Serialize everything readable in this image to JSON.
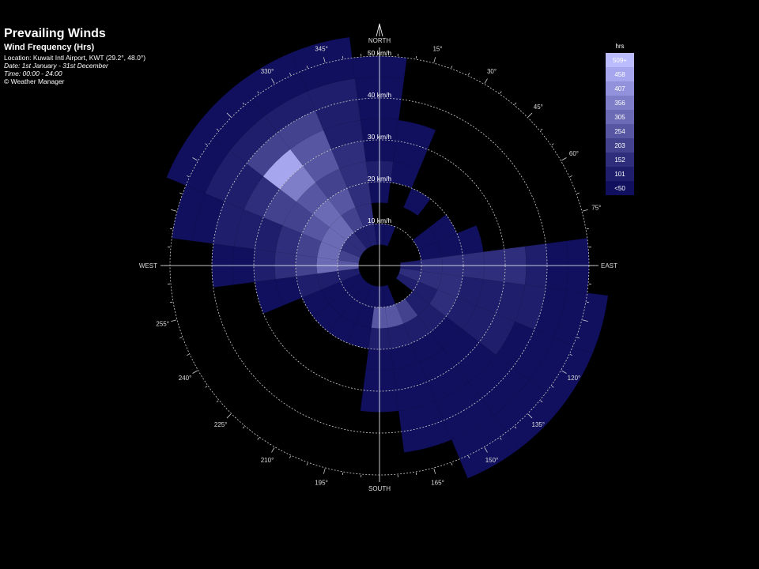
{
  "header": {
    "title": "Prevailing Winds",
    "subtitle": "Wind Frequency (Hrs)",
    "location": "Location: Kuwait Intl Airport, KWT (29.2°, 48.0°)",
    "date": "Date: 1st January - 31st December",
    "time": "Time: 00:00 - 24:00",
    "copyright": "© Weather Manager"
  },
  "chart_data": {
    "type": "wind-rose",
    "units": "km/h",
    "legend_title": "hrs",
    "cardinals": [
      "NORTH",
      "EAST",
      "SOUTH",
      "WEST"
    ],
    "speed_rings": [
      10,
      20,
      30,
      40,
      50
    ],
    "speed_labels": [
      "10 km/h",
      "20 km/h",
      "30 km/h",
      "40 km/h",
      "50 km/h"
    ],
    "direction_labels": [
      "15°",
      "30°",
      "45°",
      "60°",
      "75°",
      "120°",
      "135°",
      "150°",
      "165°",
      "195°",
      "210°",
      "225°",
      "240°",
      "255°",
      "330°",
      "345°"
    ],
    "legend": [
      {
        "label": "509+",
        "color": "#bbbbff"
      },
      {
        "label": "458",
        "color": "#a6a6ee"
      },
      {
        "label": "407",
        "color": "#9292dc"
      },
      {
        "label": "356",
        "color": "#7e7ec8"
      },
      {
        "label": "305",
        "color": "#6a6ab5"
      },
      {
        "label": "254",
        "color": "#5656a2"
      },
      {
        "label": "203",
        "color": "#42428f"
      },
      {
        "label": "152",
        "color": "#2e2e7c"
      },
      {
        "label": "101",
        "color": "#1e1e6c"
      },
      {
        "label": "<50",
        "color": "#10105e"
      }
    ],
    "colors": {
      "background": "#000000",
      "grid": "#cfcfcf"
    },
    "sector_width_deg": 15,
    "speed_bins": [
      [
        5,
        10
      ],
      [
        10,
        15
      ],
      [
        15,
        20
      ],
      [
        20,
        25
      ],
      [
        25,
        30
      ],
      [
        30,
        35
      ],
      [
        35,
        40
      ],
      [
        40,
        45
      ],
      [
        45,
        50
      ],
      [
        50,
        55
      ]
    ],
    "frequency_bins": [
      {
        "dir": 0,
        "levels": [
          1,
          0,
          1,
          2,
          1,
          1,
          1,
          1,
          1,
          0
        ]
      },
      {
        "dir": 15,
        "levels": [
          1,
          0,
          0,
          1,
          1,
          1,
          0,
          0,
          0,
          0
        ]
      },
      {
        "dir": 30,
        "levels": [
          0,
          0,
          1,
          0,
          0,
          0,
          0,
          0,
          0,
          0
        ]
      },
      {
        "dir": 45,
        "levels": [
          0,
          0,
          0,
          0,
          0,
          0,
          0,
          0,
          0,
          0
        ]
      },
      {
        "dir": 60,
        "levels": [
          0,
          1,
          1,
          0,
          0,
          0,
          0,
          0,
          0,
          0
        ]
      },
      {
        "dir": 75,
        "levels": [
          0,
          1,
          1,
          1,
          0,
          0,
          0,
          0,
          0,
          0
        ]
      },
      {
        "dir": 90,
        "levels": [
          2,
          3,
          3,
          3,
          3,
          3,
          2,
          1,
          1,
          0
        ]
      },
      {
        "dir": 105,
        "levels": [
          3,
          3,
          3,
          2,
          2,
          2,
          2,
          1,
          1,
          1
        ]
      },
      {
        "dir": 120,
        "levels": [
          2,
          2,
          3,
          2,
          2,
          2,
          1,
          1,
          1,
          1
        ]
      },
      {
        "dir": 135,
        "levels": [
          0,
          2,
          2,
          1,
          1,
          1,
          1,
          1,
          1,
          1
        ]
      },
      {
        "dir": 150,
        "levels": [
          0,
          4,
          2,
          1,
          1,
          1,
          1,
          1,
          1,
          1
        ]
      },
      {
        "dir": 165,
        "levels": [
          1,
          5,
          2,
          1,
          1,
          1,
          1,
          1,
          0,
          0
        ]
      },
      {
        "dir": 180,
        "levels": [
          1,
          5,
          2,
          1,
          1,
          1,
          0,
          0,
          0,
          0
        ]
      },
      {
        "dir": 195,
        "levels": [
          1,
          1,
          1,
          0,
          0,
          0,
          0,
          0,
          0,
          0
        ]
      },
      {
        "dir": 210,
        "levels": [
          1,
          1,
          1,
          0,
          0,
          0,
          0,
          0,
          0,
          0
        ]
      },
      {
        "dir": 225,
        "levels": [
          1,
          1,
          1,
          0,
          0,
          0,
          0,
          0,
          0,
          0
        ]
      },
      {
        "dir": 240,
        "levels": [
          1,
          1,
          1,
          0,
          0,
          0,
          0,
          0,
          0,
          0
        ]
      },
      {
        "dir": 255,
        "levels": [
          2,
          2,
          2,
          1,
          1,
          0,
          0,
          0,
          0,
          0
        ]
      },
      {
        "dir": 270,
        "levels": [
          5,
          6,
          4,
          3,
          2,
          1,
          1,
          0,
          0,
          0
        ]
      },
      {
        "dir": 285,
        "levels": [
          4,
          6,
          4,
          3,
          2,
          2,
          2,
          1,
          1,
          0
        ]
      },
      {
        "dir": 300,
        "levels": [
          3,
          6,
          5,
          4,
          4,
          3,
          2,
          2,
          1,
          1
        ]
      },
      {
        "dir": 315,
        "levels": [
          3,
          6,
          6,
          5,
          7,
          9,
          4,
          2,
          1,
          1
        ]
      },
      {
        "dir": 330,
        "levels": [
          2,
          4,
          5,
          4,
          5,
          5,
          4,
          2,
          1,
          1
        ]
      },
      {
        "dir": 345,
        "levels": [
          2,
          3,
          3,
          3,
          3,
          2,
          2,
          2,
          1,
          1
        ]
      }
    ]
  }
}
